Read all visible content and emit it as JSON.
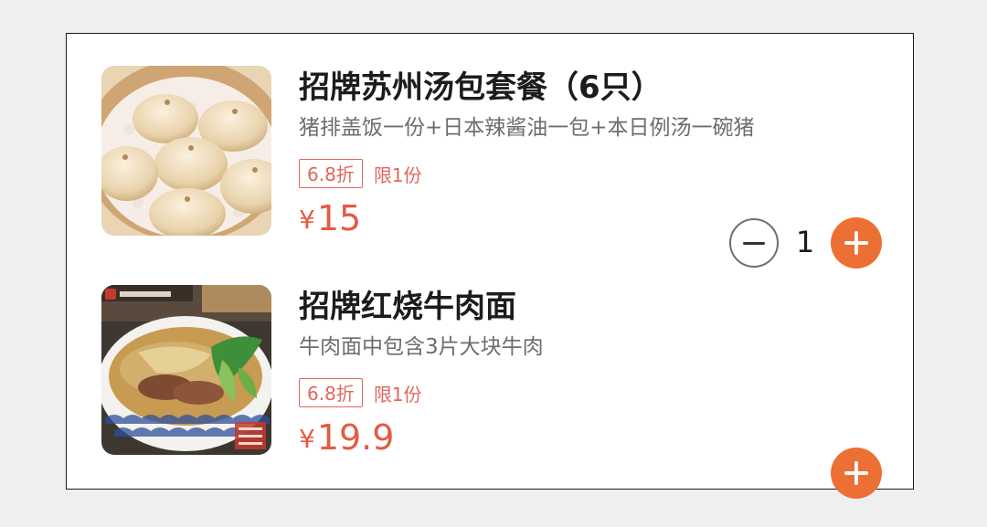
{
  "colors": {
    "accent": "#ec6f33",
    "price": "#e35b43",
    "discount": "#e0675d"
  },
  "items": [
    {
      "name": "招牌苏州汤包套餐（6只）",
      "description": "猪排盖饭一份+日本辣酱油一包+本日例汤一碗猪",
      "discount": "6.8折",
      "limit": "限1份",
      "currency": "¥",
      "price": "15",
      "quantity": "1",
      "image_icon": "soup-dumplings-photo"
    },
    {
      "name": "招牌红烧牛肉面",
      "description": "牛肉面中包含3片大块牛肉",
      "discount": "6.8折",
      "limit": "限1份",
      "currency": "¥",
      "price": "19.9",
      "image_icon": "beef-noodle-soup-photo"
    }
  ]
}
